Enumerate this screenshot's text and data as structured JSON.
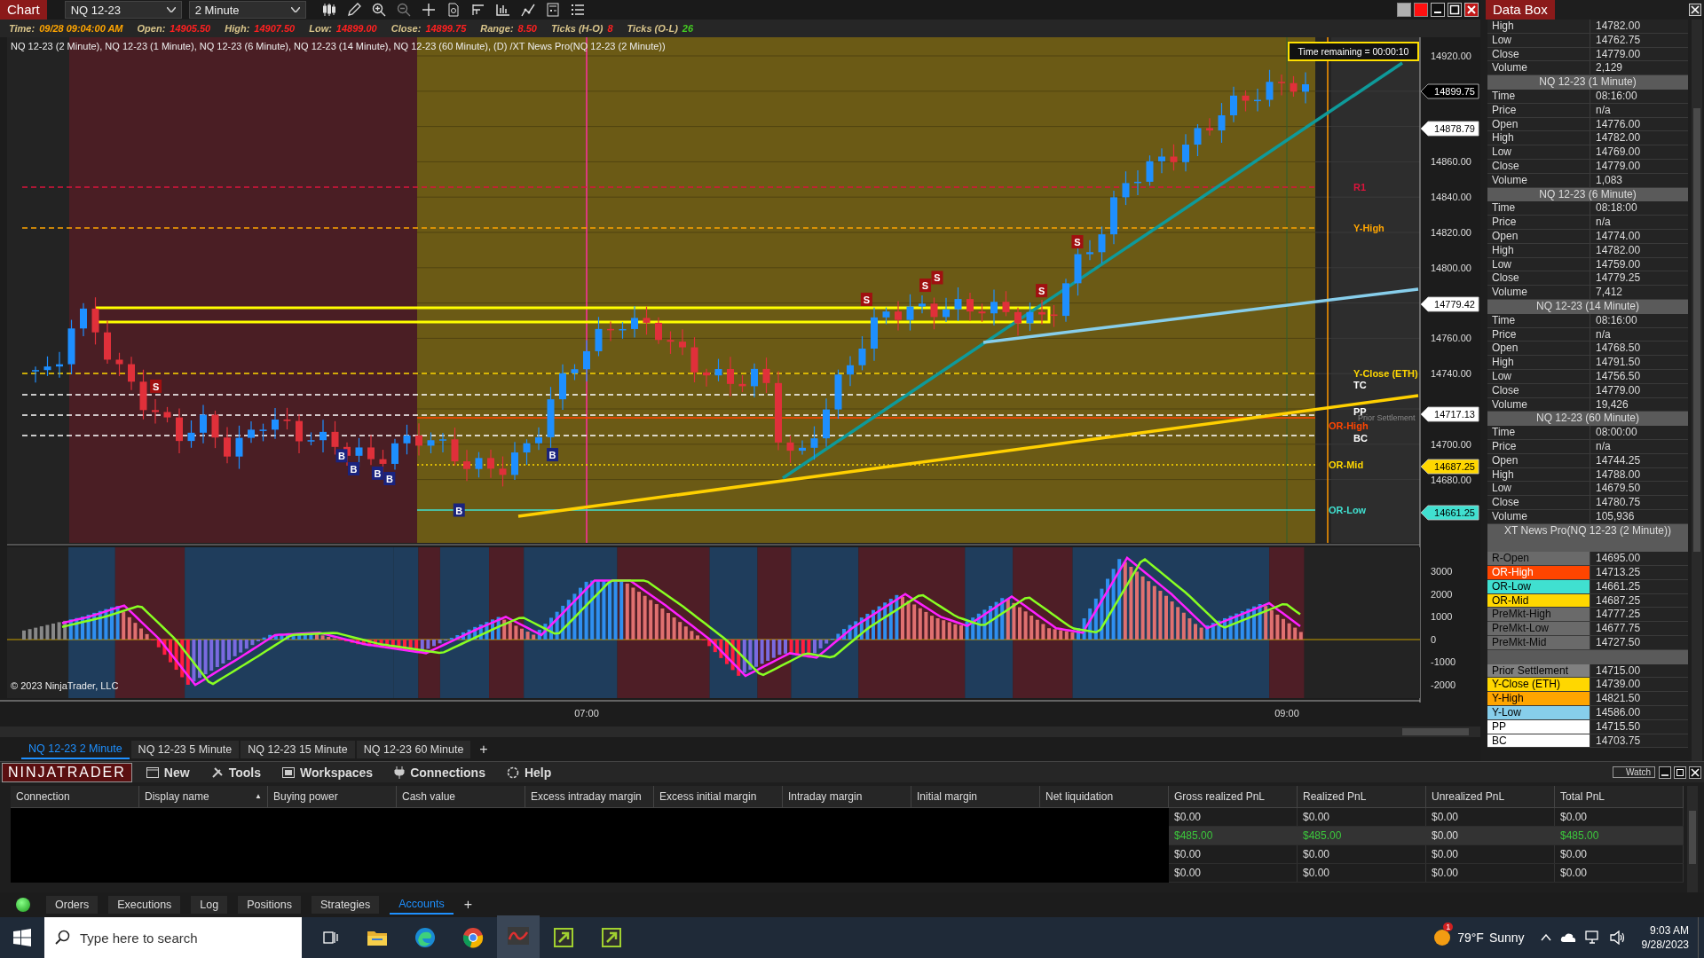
{
  "chart_window": {
    "title": "Chart",
    "instrument": "NQ 12-23",
    "interval": "2 Minute"
  },
  "info": [
    {
      "label": "Time:",
      "value": "09/28 09:04:00 AM",
      "color": "#ffa500"
    },
    {
      "label": "Open:",
      "value": "14905.50",
      "color": "#ff2020"
    },
    {
      "label": "High:",
      "value": "14907.50",
      "color": "#ff2020"
    },
    {
      "label": "Low:",
      "value": "14899.00",
      "color": "#ff2020"
    },
    {
      "label": "Close:",
      "value": "14899.75",
      "color": "#ff2020"
    },
    {
      "label": "Range:",
      "value": "8.50",
      "color": "#ff2020"
    },
    {
      "label": "Ticks (H-O)",
      "value": "8",
      "color": "#ff2020"
    },
    {
      "label": "Ticks (O-L)",
      "value": "26",
      "color": "#44cc22"
    }
  ],
  "chart": {
    "legend": "NQ 12-23 (2 Minute), NQ 12-23 (1 Minute), NQ 12-23 (6 Minute), NQ 12-23 (14 Minute), NQ 12-23 (60 Minute), (D) /XT News Pro(NQ 12-23 (2 Minute))",
    "timer": "Time remaining = 00:00:10",
    "copyright": "© 2023 NinjaTrader, LLC",
    "price_ticks": [
      "14920.00",
      "14860.00",
      "14840.00",
      "14820.00",
      "14800.00",
      "14760.00",
      "14740.00",
      "14700.00",
      "14680.00"
    ],
    "price_tags": [
      {
        "text": "14899.75",
        "color": "#000000"
      },
      {
        "text": "14878.79",
        "color": "#ffffff"
      },
      {
        "text": "14779.42",
        "color": "#ffffff"
      },
      {
        "text": "14717.13",
        "color": "#ffffff"
      },
      {
        "text": "14687.25",
        "color": "#ffd700"
      },
      {
        "text": "14661.25",
        "color": "#40e0d0"
      }
    ],
    "levels": [
      {
        "label": "R1",
        "color": "#dc143c"
      },
      {
        "label": "Y-High",
        "color": "#ffa500"
      },
      {
        "label": "Y-Close (ETH)",
        "color": "#ffd700"
      },
      {
        "label": "TC",
        "color": "#ffffff"
      },
      {
        "label": "PP",
        "color": "#ffffff"
      },
      {
        "label": "OR-High",
        "color": "#ff4500"
      },
      {
        "label": "BC",
        "color": "#ffffff"
      },
      {
        "label": "OR-Mid",
        "color": "#ffd700"
      },
      {
        "label": "OR-Low",
        "color": "#40e0d0"
      }
    ],
    "prior_settlement_label": "Prior Settlement",
    "markers": [
      {
        "kind": "sell",
        "text": "S"
      },
      {
        "kind": "sell",
        "text": "S"
      },
      {
        "kind": "sell",
        "text": "S"
      },
      {
        "kind": "sell",
        "text": "S"
      },
      {
        "kind": "sell",
        "text": "S"
      },
      {
        "kind": "sell",
        "text": "S"
      },
      {
        "kind": "buy",
        "text": "B"
      },
      {
        "kind": "buy",
        "text": "B"
      },
      {
        "kind": "buy",
        "text": "B"
      },
      {
        "kind": "buy",
        "text": "B"
      },
      {
        "kind": "buy",
        "text": "B"
      },
      {
        "kind": "buy",
        "text": "B"
      }
    ],
    "indicator_ticks": [
      "3000",
      "2000",
      "1000",
      "0",
      "-1000",
      "-2000"
    ],
    "time_ticks": [
      "07:00",
      "09:00"
    ]
  },
  "chart_tabs": [
    {
      "label": "NQ 12-23 2 Minute",
      "selected": true
    },
    {
      "label": "NQ 12-23 5 Minute",
      "selected": false
    },
    {
      "label": "NQ 12-23 15 Minute",
      "selected": false
    },
    {
      "label": "NQ 12-23 60 Minute",
      "selected": false
    }
  ],
  "add_tab": "+",
  "data_box": {
    "title": "Data Box",
    "rows": [
      {
        "kind": "row",
        "label": "High",
        "value": "14782.00"
      },
      {
        "kind": "row",
        "label": "Low",
        "value": "14762.75"
      },
      {
        "kind": "row",
        "label": "Close",
        "value": "14779.00"
      },
      {
        "kind": "row",
        "label": "Volume",
        "value": "2,129"
      },
      {
        "kind": "header",
        "text": "NQ 12-23 (1 Minute)"
      },
      {
        "kind": "row",
        "label": "Time",
        "value": "08:16:00"
      },
      {
        "kind": "row",
        "label": "Price",
        "value": "n/a"
      },
      {
        "kind": "row",
        "label": "Open",
        "value": "14776.00"
      },
      {
        "kind": "row",
        "label": "High",
        "value": "14782.00"
      },
      {
        "kind": "row",
        "label": "Low",
        "value": "14769.00"
      },
      {
        "kind": "row",
        "label": "Close",
        "value": "14779.00"
      },
      {
        "kind": "row",
        "label": "Volume",
        "value": "1,083"
      },
      {
        "kind": "header",
        "text": "NQ 12-23 (6 Minute)"
      },
      {
        "kind": "row",
        "label": "Time",
        "value": "08:18:00"
      },
      {
        "kind": "row",
        "label": "Price",
        "value": "n/a"
      },
      {
        "kind": "row",
        "label": "Open",
        "value": "14774.00"
      },
      {
        "kind": "row",
        "label": "High",
        "value": "14782.00"
      },
      {
        "kind": "row",
        "label": "Low",
        "value": "14759.00"
      },
      {
        "kind": "row",
        "label": "Close",
        "value": "14779.25"
      },
      {
        "kind": "row",
        "label": "Volume",
        "value": "7,412"
      },
      {
        "kind": "header",
        "text": "NQ 12-23 (14 Minute)"
      },
      {
        "kind": "row",
        "label": "Time",
        "value": "08:16:00"
      },
      {
        "kind": "row",
        "label": "Price",
        "value": "n/a"
      },
      {
        "kind": "row",
        "label": "Open",
        "value": "14768.50"
      },
      {
        "kind": "row",
        "label": "High",
        "value": "14791.50"
      },
      {
        "kind": "row",
        "label": "Low",
        "value": "14756.50"
      },
      {
        "kind": "row",
        "label": "Close",
        "value": "14779.00"
      },
      {
        "kind": "row",
        "label": "Volume",
        "value": "19,426"
      },
      {
        "kind": "header",
        "text": "NQ 12-23 (60 Minute)"
      },
      {
        "kind": "row",
        "label": "Time",
        "value": "08:00:00"
      },
      {
        "kind": "row",
        "label": "Price",
        "value": "n/a"
      },
      {
        "kind": "row",
        "label": "Open",
        "value": "14744.25"
      },
      {
        "kind": "row",
        "label": "High",
        "value": "14788.00"
      },
      {
        "kind": "row",
        "label": "Low",
        "value": "14679.50"
      },
      {
        "kind": "row",
        "label": "Close",
        "value": "14780.75"
      },
      {
        "kind": "row",
        "label": "Volume",
        "value": "105,936"
      },
      {
        "kind": "header",
        "text": "XT News Pro(NQ 12-23 (2 Minute))"
      },
      {
        "kind": "blank"
      },
      {
        "kind": "row",
        "label": "R-Open",
        "value": "14695.00",
        "muted": true
      },
      {
        "kind": "row",
        "label": "OR-High",
        "value": "14713.25",
        "color": "#ff4500"
      },
      {
        "kind": "row",
        "label": "OR-Low",
        "value": "14661.25",
        "color": "#40e0d0"
      },
      {
        "kind": "row",
        "label": "OR-Mid",
        "value": "14687.25",
        "color": "#ffd700"
      },
      {
        "kind": "row",
        "label": "PreMkt-High",
        "value": "14777.25",
        "muted": true
      },
      {
        "kind": "row",
        "label": "PreMkt-Low",
        "value": "14677.75",
        "muted": true
      },
      {
        "kind": "row",
        "label": "PreMkt-Mid",
        "value": "14727.50",
        "muted": true
      },
      {
        "kind": "blank"
      },
      {
        "kind": "row",
        "label": "Prior Settlement",
        "value": "14715.00",
        "color": "#808080"
      },
      {
        "kind": "row",
        "label": "Y-Close (ETH)",
        "value": "14739.00",
        "color": "#ffd700"
      },
      {
        "kind": "row",
        "label": "Y-High",
        "value": "14821.50",
        "color": "#ffa500"
      },
      {
        "kind": "row",
        "label": "Y-Low",
        "value": "14586.00",
        "color": "#87ceeb"
      },
      {
        "kind": "row",
        "label": "PP",
        "value": "14715.50",
        "color": "#ffffff"
      },
      {
        "kind": "row",
        "label": "BC",
        "value": "14703.75",
        "color": "#ffffff"
      }
    ]
  },
  "control_center": {
    "logo": "NINJATRADER",
    "menu": [
      "New",
      "Tools",
      "Workspaces",
      "Connections",
      "Help"
    ],
    "watch": "Watch"
  },
  "accounts": {
    "columns": [
      "Connection",
      "Display name",
      "Buying power",
      "Cash value",
      "Excess intraday margin",
      "Excess initial margin",
      "Intraday margin",
      "Initial margin",
      "Net liquidation",
      "Gross realized PnL",
      "Realized PnL",
      "Unrealized PnL",
      "Total PnL"
    ],
    "sort_indicator": "▲",
    "rows": [
      {
        "selected": false,
        "cells": [
          {
            "text": "$0.00",
            "positive": false
          },
          {
            "text": "$0.00",
            "positive": false
          },
          {
            "text": "$0.00",
            "positive": false
          },
          {
            "text": "$0.00",
            "positive": false
          }
        ]
      },
      {
        "selected": true,
        "cells": [
          {
            "text": "$485.00",
            "positive": true
          },
          {
            "text": "$485.00",
            "positive": true
          },
          {
            "text": "$0.00",
            "positive": false
          },
          {
            "text": "$485.00",
            "positive": true
          }
        ]
      },
      {
        "selected": false,
        "cells": [
          {
            "text": "$0.00",
            "positive": false
          },
          {
            "text": "$0.00",
            "positive": false
          },
          {
            "text": "$0.00",
            "positive": false
          },
          {
            "text": "$0.00",
            "positive": false
          }
        ]
      },
      {
        "selected": false,
        "cells": [
          {
            "text": "$0.00",
            "positive": false
          },
          {
            "text": "$0.00",
            "positive": false
          },
          {
            "text": "$0.00",
            "positive": false
          },
          {
            "text": "$0.00",
            "positive": false
          }
        ]
      }
    ]
  },
  "bottom_tabs": [
    {
      "label": "Orders",
      "selected": false
    },
    {
      "label": "Executions",
      "selected": false
    },
    {
      "label": "Log",
      "selected": false
    },
    {
      "label": "Positions",
      "selected": false
    },
    {
      "label": "Strategies",
      "selected": false
    },
    {
      "label": "Accounts",
      "selected": true
    }
  ],
  "bottom_add": "+",
  "taskbar": {
    "search": {
      "placeholder": "Type here to search"
    },
    "weather_badge": "1",
    "temperature": "79°F",
    "condition": "Sunny",
    "time": "9:03 AM",
    "date": "9/28/2023"
  }
}
